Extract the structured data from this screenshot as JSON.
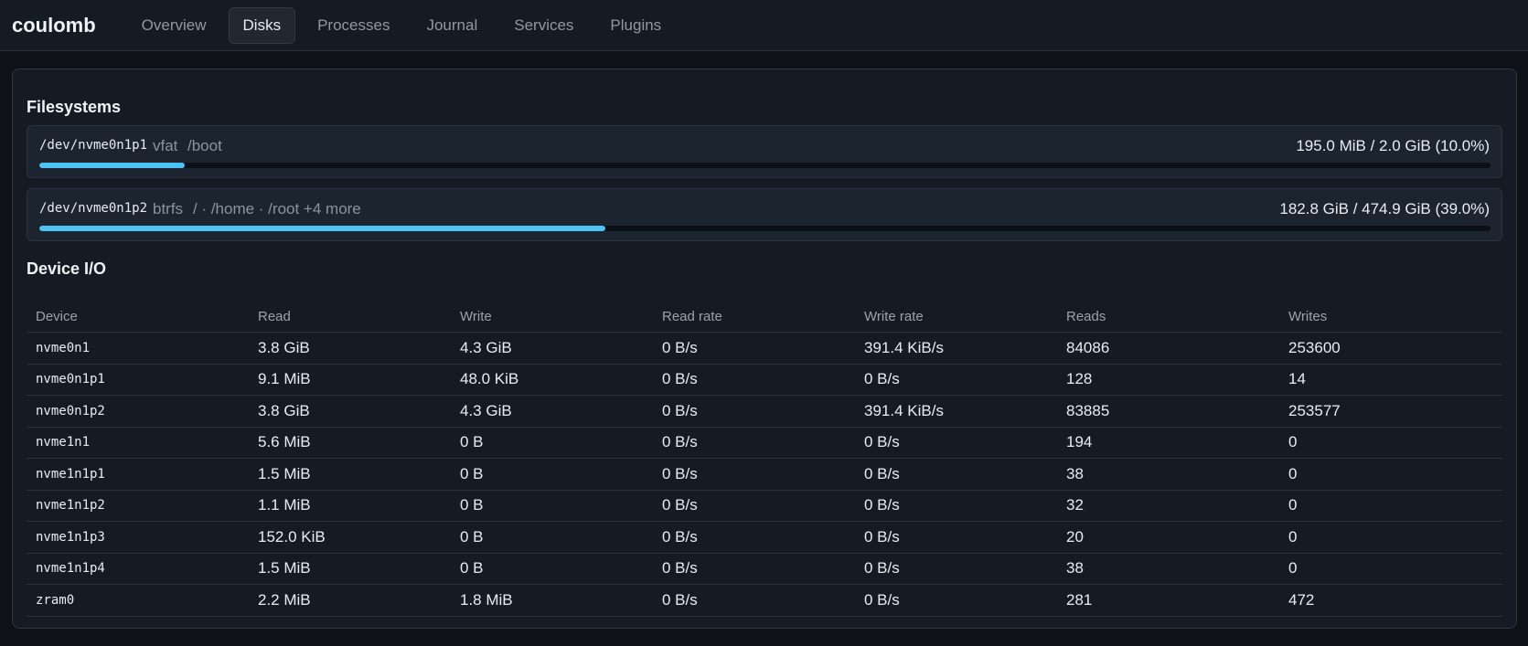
{
  "app": {
    "title": "coulomb"
  },
  "nav": {
    "tabs": [
      {
        "label": "Overview",
        "active": false
      },
      {
        "label": "Disks",
        "active": true
      },
      {
        "label": "Processes",
        "active": false
      },
      {
        "label": "Journal",
        "active": false
      },
      {
        "label": "Services",
        "active": false
      },
      {
        "label": "Plugins",
        "active": false
      }
    ]
  },
  "filesystems": {
    "title": "Filesystems",
    "items": [
      {
        "device": "/dev/nvme0n1p1",
        "fstype": "vfat",
        "mounts": "/boot",
        "usage": "195.0 MiB / 2.0 GiB (10.0%)",
        "percent": 10.0
      },
      {
        "device": "/dev/nvme0n1p2",
        "fstype": "btrfs",
        "mounts": "/ · /home · /root +4 more",
        "usage": "182.8 GiB / 474.9 GiB (39.0%)",
        "percent": 39.0
      }
    ]
  },
  "device_io": {
    "title": "Device I/O",
    "columns": [
      "Device",
      "Read",
      "Write",
      "Read rate",
      "Write rate",
      "Reads",
      "Writes"
    ],
    "rows": [
      [
        "nvme0n1",
        "3.8 GiB",
        "4.3 GiB",
        "0 B/s",
        "391.4 KiB/s",
        "84086",
        "253600"
      ],
      [
        "nvme0n1p1",
        "9.1 MiB",
        "48.0 KiB",
        "0 B/s",
        "0 B/s",
        "128",
        "14"
      ],
      [
        "nvme0n1p2",
        "3.8 GiB",
        "4.3 GiB",
        "0 B/s",
        "391.4 KiB/s",
        "83885",
        "253577"
      ],
      [
        "nvme1n1",
        "5.6 MiB",
        "0 B",
        "0 B/s",
        "0 B/s",
        "194",
        "0"
      ],
      [
        "nvme1n1p1",
        "1.5 MiB",
        "0 B",
        "0 B/s",
        "0 B/s",
        "38",
        "0"
      ],
      [
        "nvme1n1p2",
        "1.1 MiB",
        "0 B",
        "0 B/s",
        "0 B/s",
        "32",
        "0"
      ],
      [
        "nvme1n1p3",
        "152.0 KiB",
        "0 B",
        "0 B/s",
        "0 B/s",
        "20",
        "0"
      ],
      [
        "nvme1n1p4",
        "1.5 MiB",
        "0 B",
        "0 B/s",
        "0 B/s",
        "38",
        "0"
      ],
      [
        "zram0",
        "2.2 MiB",
        "1.8 MiB",
        "0 B/s",
        "0 B/s",
        "281",
        "472"
      ]
    ]
  },
  "colors": {
    "accent": "#4cc2f5",
    "background": "#0e1116",
    "panel": "#151b23"
  }
}
